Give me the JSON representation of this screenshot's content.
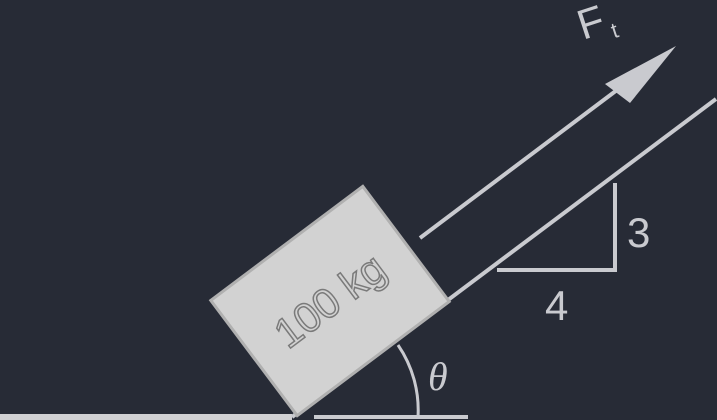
{
  "diagram": {
    "mass_label": "100 kg",
    "force_label": "F",
    "force_subscript": "t",
    "angle_label": "θ",
    "slope_rise_label": "3",
    "slope_run_label": "4"
  },
  "colors": {
    "background": "#272b36",
    "stroke": "#c9cacf",
    "block_fill": "#d2d2d2",
    "block_edge": "#b0b0b0",
    "ground": "#d0d0d3"
  }
}
